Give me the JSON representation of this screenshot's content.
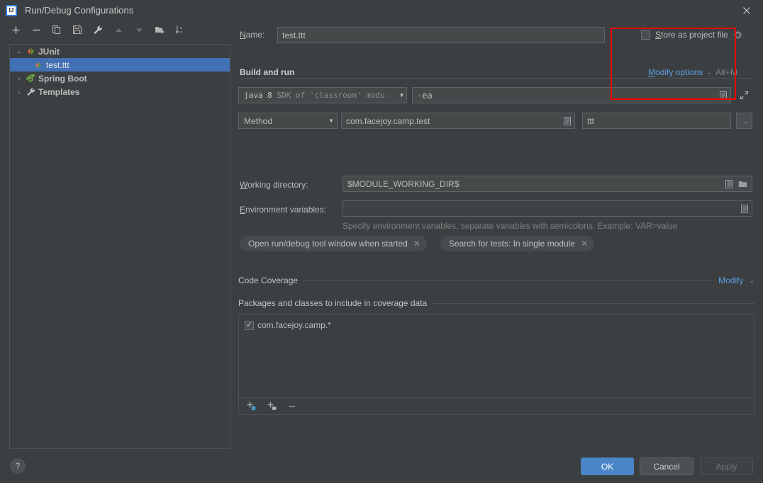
{
  "window": {
    "title": "Run/Debug Configurations",
    "logo_text": "IJ",
    "close_label": "✕"
  },
  "sidebar": {
    "toolbar": [
      {
        "name": "add-configuration-button",
        "glyph": "+"
      },
      {
        "name": "remove-configuration-button",
        "glyph": "−"
      },
      {
        "name": "copy-configuration-button",
        "glyph": "copy"
      },
      {
        "name": "save-configuration-button",
        "glyph": "save"
      },
      {
        "name": "edit-templates-button",
        "glyph": "wrench"
      },
      {
        "name": "move-up-button",
        "glyph": "▲"
      },
      {
        "name": "move-down-button",
        "glyph": "▼"
      },
      {
        "name": "new-folder-button",
        "glyph": "folder-plus"
      },
      {
        "name": "sort-configurations-button",
        "glyph": "sort-az"
      }
    ],
    "tree": [
      {
        "label": "JUnit",
        "icon": "junit-icon",
        "expanded": true,
        "arrow": "⌄",
        "level": 0,
        "selected": false,
        "bold": true
      },
      {
        "label": "test.ttt",
        "icon": "junit-icon",
        "expanded": false,
        "arrow": "",
        "level": 1,
        "selected": true,
        "bold": false
      },
      {
        "label": "Spring Boot",
        "icon": "spring-boot-icon",
        "expanded": false,
        "arrow": "›",
        "level": 0,
        "selected": false,
        "bold": true
      },
      {
        "label": "Templates",
        "icon": "wrench-icon",
        "expanded": false,
        "arrow": "›",
        "level": 0,
        "selected": false,
        "bold": true
      }
    ]
  },
  "main": {
    "name_label": "Name:",
    "name_label_mnemonic": "N",
    "name_value": "test.ttt",
    "store_as_project_file_label": "Store as project file",
    "store_as_project_file_mnemonic": "S",
    "store_as_project_file_checked": false,
    "store_gear_icon": "gear-icon",
    "build_and_run_header": "Build and run",
    "modify_options_link": "Modify options",
    "modify_options_mnemonic": "M",
    "modify_options_shortcut": "Alt+M",
    "jre_value_strong": "java 8",
    "jre_value_dim": "SDK of 'classroom' modu",
    "vm_options_value": "-ea",
    "test_kind_value": "Method",
    "class_value": "com.facejoy.camp.test",
    "method_value": "ttt",
    "browse_button_label": "...",
    "working_directory_label": "Working directory:",
    "working_directory_mnemonic": "W",
    "working_directory_value": "$MODULE_WORKING_DIR$",
    "environment_variables_label": "Environment variables:",
    "environment_variables_mnemonic": "E",
    "environment_variables_value": "",
    "environment_hint": "Specify environment variables, separate variables with semicolons. Example: VAR=value",
    "chips": [
      {
        "label": "Open run/debug tool window when started",
        "close": "✕"
      },
      {
        "label": "Search for tests: In single module",
        "close": "✕"
      }
    ],
    "code_coverage_header": "Code Coverage",
    "code_coverage_modify_link": "Modify",
    "packages_header": "Packages and classes to include in coverage data",
    "coverage_items": [
      {
        "label": "com.facejoy.camp.*",
        "checked": true
      }
    ],
    "coverage_toolbar": [
      {
        "name": "add-class-button",
        "glyph": "add-class"
      },
      {
        "name": "add-package-button",
        "glyph": "add-package"
      },
      {
        "name": "remove-pattern-button",
        "glyph": "−"
      }
    ]
  },
  "footer": {
    "help_label": "?",
    "ok_label": "OK",
    "cancel_label": "Cancel",
    "apply_label": "Apply",
    "apply_enabled": false
  },
  "annotation": {
    "highlight_color": "#ff0000"
  }
}
